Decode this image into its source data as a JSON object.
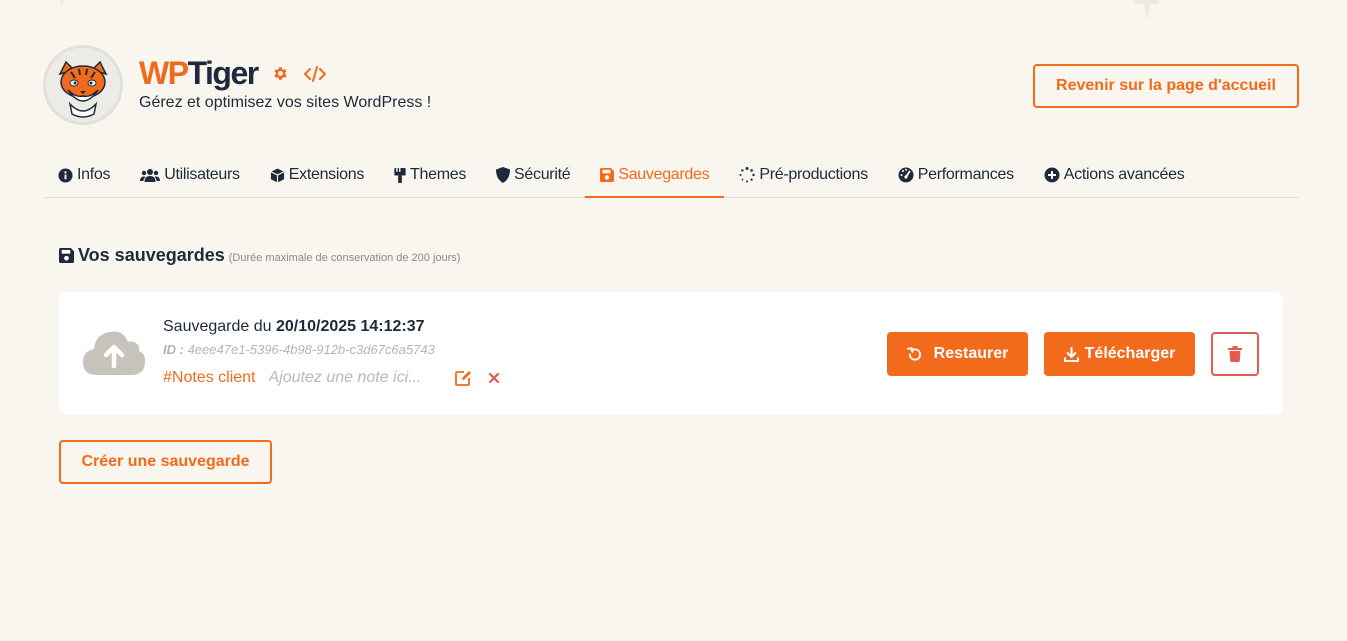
{
  "header": {
    "brand_part1": "WP",
    "brand_part2": "Tiger",
    "tagline": "Gérez et optimisez vos sites WordPress !",
    "settings_icon": "gear-icon",
    "code_icon": "code-icon",
    "home_button": "Revenir sur la page d'accueil"
  },
  "tabs": [
    {
      "label": "Infos",
      "icon": "info-circle-icon",
      "active": false
    },
    {
      "label": "Utilisateurs",
      "icon": "users-icon",
      "active": false
    },
    {
      "label": "Extensions",
      "icon": "cube-icon",
      "active": false
    },
    {
      "label": "Themes",
      "icon": "paint-brush-icon",
      "active": false
    },
    {
      "label": "Sécurité",
      "icon": "shield-icon",
      "active": false
    },
    {
      "label": "Sauvegardes",
      "icon": "floppy-disk-icon",
      "active": true
    },
    {
      "label": "Pré-productions",
      "icon": "spinner-icon",
      "active": false
    },
    {
      "label": "Performances",
      "icon": "gauge-icon",
      "active": false
    },
    {
      "label": "Actions avancées",
      "icon": "plus-circle-icon",
      "active": false
    }
  ],
  "section": {
    "title": "Vos sauvegardes",
    "subtitle": "(Durée maximale de conservation de 200 jours)",
    "icon": "floppy-disk-icon"
  },
  "backup": {
    "date_prefix": "Sauvegarde du",
    "date_value": "20/10/2025 14:12:37",
    "id_label": "ID :",
    "id_value": "4eee47e1-5396-4b98-912b-c3d67c6a5743",
    "notes_label": "#Notes client",
    "notes_placeholder": "Ajoutez une note ici...",
    "restore_label": "Restaurer",
    "download_label": "Télécharger",
    "icon": "cloud-upload-icon"
  },
  "create_button": "Créer une sauvegarde",
  "colors": {
    "accent": "#f26a1b",
    "text_dark": "#1e2a3b",
    "danger": "#e35a4e",
    "background": "#f9f6f0",
    "card": "#ffffff"
  }
}
